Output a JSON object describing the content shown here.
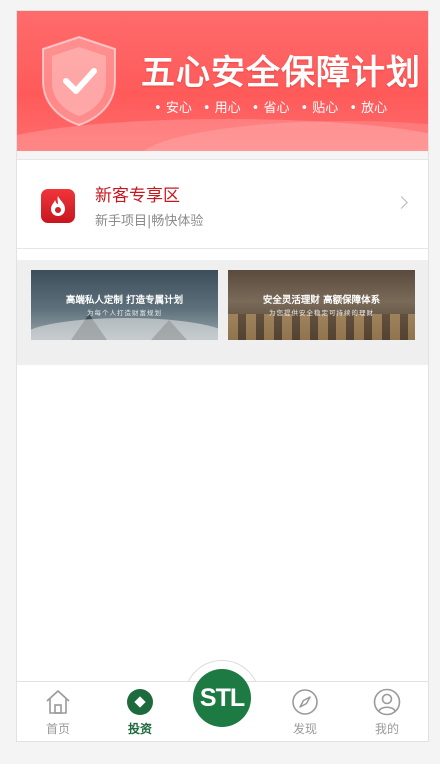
{
  "banner": {
    "title": "五心安全保障计划",
    "tags": [
      "安心",
      "用心",
      "省心",
      "贴心",
      "放心"
    ]
  },
  "new_customer": {
    "title": "新客专享区",
    "subtitle": "新手项目|畅快体验"
  },
  "promos": [
    {
      "title": "高端私人定制 打造专属计划",
      "subtitle": "为每个人打造财富规划"
    },
    {
      "title": "安全灵活理财 高额保障体系",
      "subtitle": "为您提供安全稳定可持续的理财"
    }
  ],
  "tabbar": {
    "items": [
      {
        "label": "首页",
        "icon": "home-icon",
        "active": false
      },
      {
        "label": "投资",
        "icon": "invest-icon",
        "active": true
      },
      {
        "label": "发现",
        "icon": "compass-icon",
        "active": false
      },
      {
        "label": "我的",
        "icon": "user-icon",
        "active": false
      }
    ],
    "center_logo": "STL"
  },
  "colors": {
    "banner_red": "#ff5a5a",
    "accent_red": "#c8161e",
    "brand_green": "#1d7a43",
    "inactive_gray": "#9a9a9a"
  }
}
